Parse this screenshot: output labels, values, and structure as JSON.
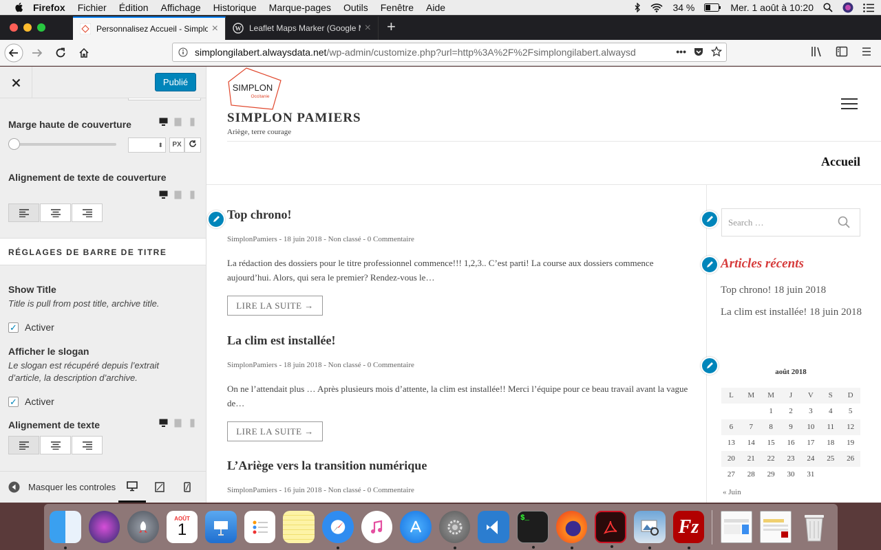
{
  "menubar": {
    "app": "Firefox",
    "items": [
      "Fichier",
      "Édition",
      "Affichage",
      "Historique",
      "Marque-pages",
      "Outils",
      "Fenêtre",
      "Aide"
    ],
    "battery": "34 %",
    "datetime": "Mer. 1 août à 10:20"
  },
  "tabs": [
    {
      "title": "Personnalisez Accueil - Simplon",
      "active": true
    },
    {
      "title": "Leaflet Maps Marker (Google M",
      "active": false
    }
  ],
  "url": {
    "host": "simplongilabert.alwaysdata.net",
    "path": "/wp-admin/customize.php?url=http%3A%2F%2Fsimplongilabert.alwaysd"
  },
  "panel": {
    "publish_label": "Publié",
    "cover_margin_title": "Marge haute de couverture",
    "cover_margin_unit": "PX",
    "cover_align_title": "Alignement de texte de couverture",
    "section_title": "RÉGLAGES DE BARRE DE TITRE",
    "show_title": "Show Title",
    "show_title_desc": "Title is pull from post title, archive title.",
    "activate_label": "Activer",
    "slogan_title": "Afficher le slogan",
    "slogan_desc": "Le slogan est récupéré depuis l’extrait d’article, la description d’archive.",
    "activate_label_2": "Activer",
    "text_align_title": "Alignement de texte",
    "hide_controls": "Masquer les controles"
  },
  "site": {
    "logo_text": "SIMPLON",
    "logo_sub": "Occitanie",
    "title": "SIMPLON PAMIERS",
    "tagline": "Ariège, terre courage",
    "page_title": "Accueil",
    "read_more": "LIRE LA SUITE →",
    "posts": [
      {
        "title": "Top chrono!",
        "meta": "SimplonPamiers - 18 juin 2018 - Non classé - 0 Commentaire",
        "excerpt": "La rédaction des dossiers pour le titre professionnel commence!!! 1,2,3.. C’est parti! La course aux dossiers commence aujourd’hui. Alors, qui sera le premier? Rendez-vous le…"
      },
      {
        "title": "La clim est installée!",
        "meta": "SimplonPamiers - 18 juin 2018 - Non classé - 0 Commentaire",
        "excerpt": "On ne l’attendait plus … Après plusieurs mois d’attente, la clim est installée!!     Merci l’équipe pour ce beau travail avant la vague de…"
      },
      {
        "title": "L’Ariège vers la transition numérique",
        "meta": "SimplonPamiers - 16 juin 2018 - Non classé - 0 Commentaire"
      }
    ],
    "search_placeholder": "Search …",
    "recent_title": "Articles récents",
    "recent": [
      "Top chrono! 18 juin 2018",
      "La clim est installée! 18 juin 2018"
    ],
    "calendar": {
      "caption": "août 2018",
      "days": [
        "L",
        "M",
        "M",
        "J",
        "V",
        "S",
        "D"
      ],
      "weeks": [
        [
          "",
          "",
          "1",
          "2",
          "3",
          "4",
          "5"
        ],
        [
          "6",
          "7",
          "8",
          "9",
          "10",
          "11",
          "12"
        ],
        [
          "13",
          "14",
          "15",
          "16",
          "17",
          "18",
          "19"
        ],
        [
          "20",
          "21",
          "22",
          "23",
          "24",
          "25",
          "26"
        ],
        [
          "27",
          "28",
          "29",
          "30",
          "31",
          "",
          ""
        ]
      ],
      "prev": "« Juin"
    }
  },
  "dock": {
    "calendar_month": "AOÛT",
    "calendar_day": "1",
    "apps": [
      "Finder",
      "Siri",
      "Launchpad",
      "Calendrier",
      "Keynote",
      "Rappels",
      "Notes",
      "Safari",
      "iTunes",
      "App Store",
      "Préférences Système",
      "Visual Studio Code",
      "Terminal",
      "Firefox",
      "Acrobat",
      "Aperçu",
      "FileZilla"
    ]
  },
  "colors": {
    "accent": "#0085ba",
    "widget_title": "#d63b3b",
    "tab_highlight": "#0a84ff"
  }
}
